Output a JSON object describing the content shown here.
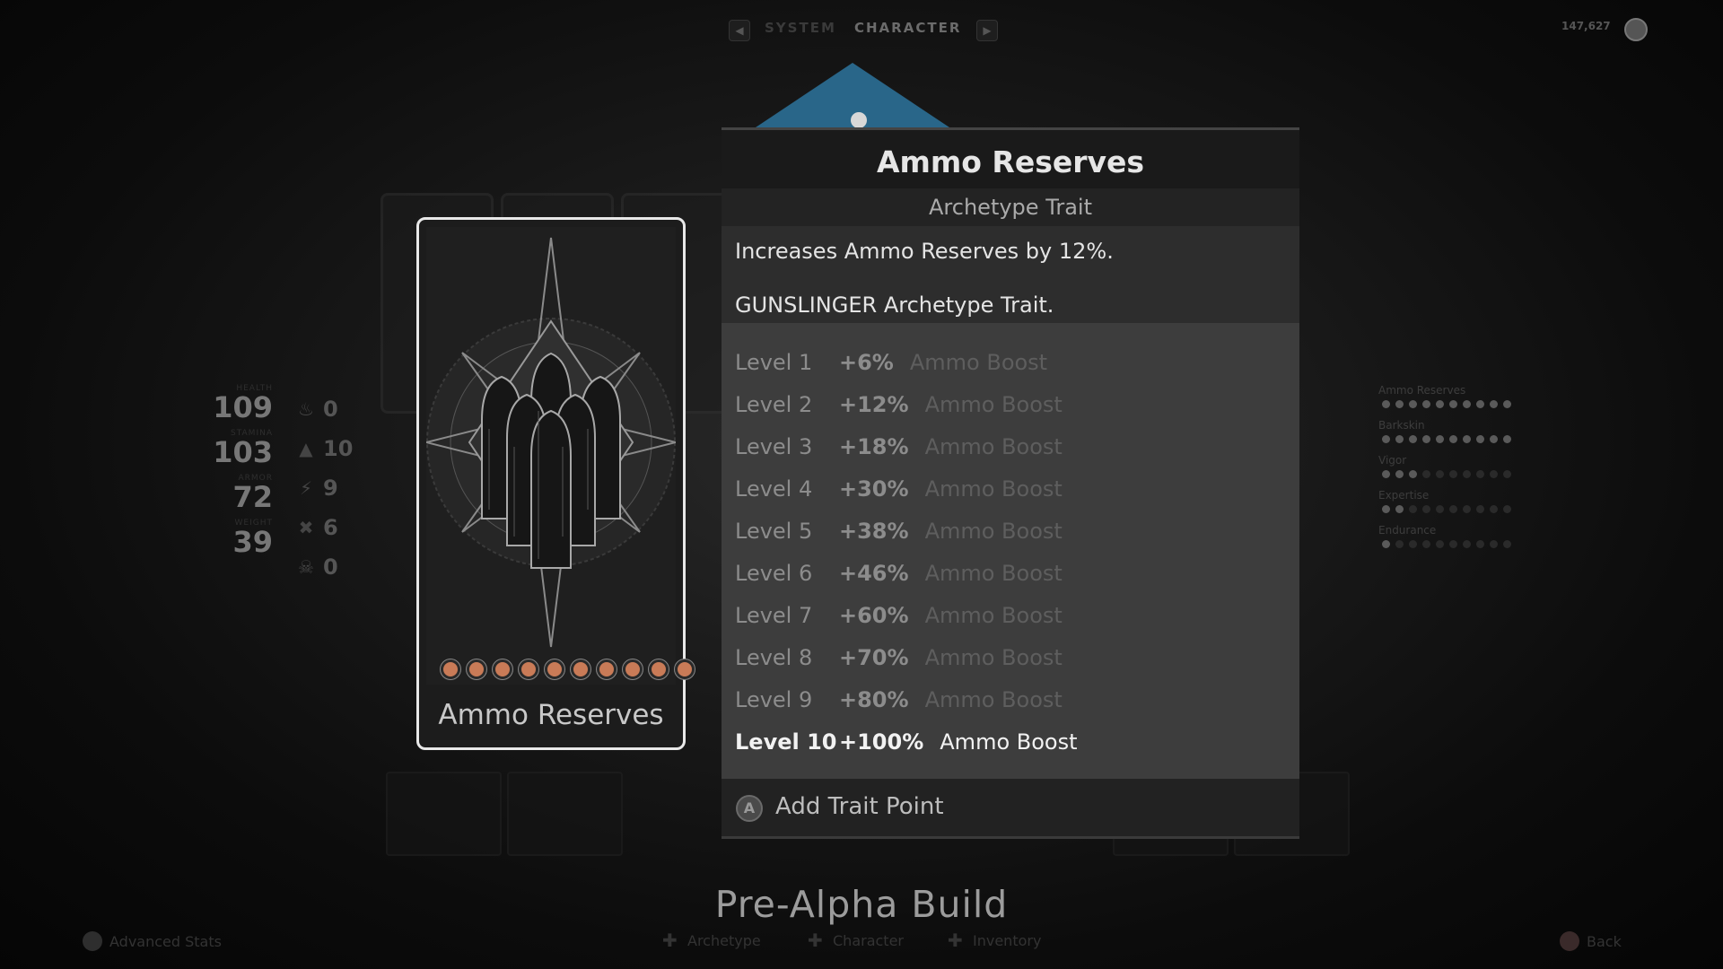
{
  "nav": {
    "tabs": [
      "SYSTEM",
      "CHARACTER"
    ],
    "active_tab": "CHARACTER",
    "currency_value": "147,627"
  },
  "stats": [
    {
      "label": "HEALTH",
      "value": "109"
    },
    {
      "label": "STAMINA",
      "value": "103"
    },
    {
      "label": "ARMOR",
      "value": "72"
    },
    {
      "label": "WEIGHT",
      "value": "39"
    }
  ],
  "resistances": [
    {
      "icon": "fire-icon",
      "value": "0"
    },
    {
      "icon": "acid-icon",
      "value": "10"
    },
    {
      "icon": "shock-icon",
      "value": "9"
    },
    {
      "icon": "bleed-icon",
      "value": "6"
    },
    {
      "icon": "skull-icon",
      "value": "0"
    }
  ],
  "attributes": [
    {
      "name": "Ammo Reserves",
      "filled": 10,
      "total": 10
    },
    {
      "name": "Barkskin",
      "filled": 10,
      "total": 10
    },
    {
      "name": "Vigor",
      "filled": 3,
      "total": 10
    },
    {
      "name": "Expertise",
      "filled": 2,
      "total": 10
    },
    {
      "name": "Endurance",
      "filled": 1,
      "total": 10
    }
  ],
  "card": {
    "title": "Ammo Reserves",
    "icon": "bullets-icon",
    "points": 10,
    "pip_color": "#c97b57"
  },
  "panel": {
    "title": "Ammo Reserves",
    "subtitle": "Archetype Trait",
    "description": "Increases Ammo Reserves by 12%.",
    "archetype_note": "GUNSLINGER Archetype Trait.",
    "levels": [
      {
        "label": "Level 1",
        "pct": "+6%",
        "effect": "Ammo Boost"
      },
      {
        "label": "Level 2",
        "pct": "+12%",
        "effect": "Ammo Boost"
      },
      {
        "label": "Level 3",
        "pct": "+18%",
        "effect": "Ammo Boost"
      },
      {
        "label": "Level 4",
        "pct": "+30%",
        "effect": "Ammo Boost"
      },
      {
        "label": "Level 5",
        "pct": "+38%",
        "effect": "Ammo Boost"
      },
      {
        "label": "Level 6",
        "pct": "+46%",
        "effect": "Ammo Boost"
      },
      {
        "label": "Level 7",
        "pct": "+60%",
        "effect": "Ammo Boost"
      },
      {
        "label": "Level 8",
        "pct": "+70%",
        "effect": "Ammo Boost"
      },
      {
        "label": "Level 9",
        "pct": "+80%",
        "effect": "Ammo Boost"
      },
      {
        "label": "Level 10",
        "pct": "+100%",
        "effect": "Ammo Boost"
      }
    ],
    "current_level": 10,
    "action_button_glyph": "A",
    "action_label": "Add Trait Point"
  },
  "watermark": "Pre-Alpha Build",
  "footer": {
    "advanced_stats": "Advanced Stats",
    "archetype": "Archetype",
    "character": "Character",
    "inventory": "Inventory",
    "back": "Back"
  }
}
